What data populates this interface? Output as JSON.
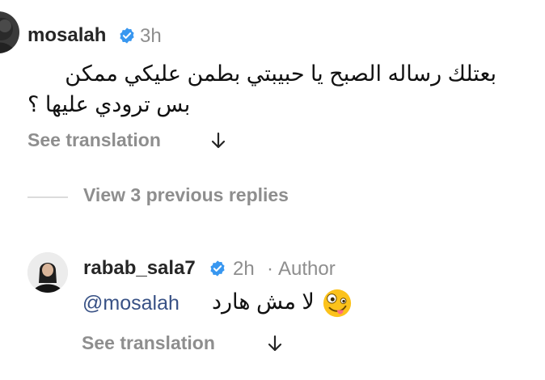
{
  "comment": {
    "username": "mosalah",
    "time": "3h",
    "text_line1": "بعتلك رساله الصبح يا حبيبتي بطمن عليكي ممكن",
    "text_line2": "بس ترودي عليها ؟",
    "see_translation": "See translation",
    "avatar_icon": "profile-photo",
    "verified_icon": "verified-badge-icon",
    "verified_color": "#3897f0"
  },
  "replies": {
    "view_label": "View 3 previous replies"
  },
  "reply": {
    "username": "rabab_sala7",
    "time": "2h",
    "separator": "·",
    "author_label": "Author",
    "mention": "@mosalah",
    "text": "لا مش هارد",
    "emoji_icon": "zany-face-emoji",
    "see_translation": "See translation",
    "mention_color": "#385185"
  },
  "icons": {
    "translation_arrow": "arrow-down-icon"
  }
}
